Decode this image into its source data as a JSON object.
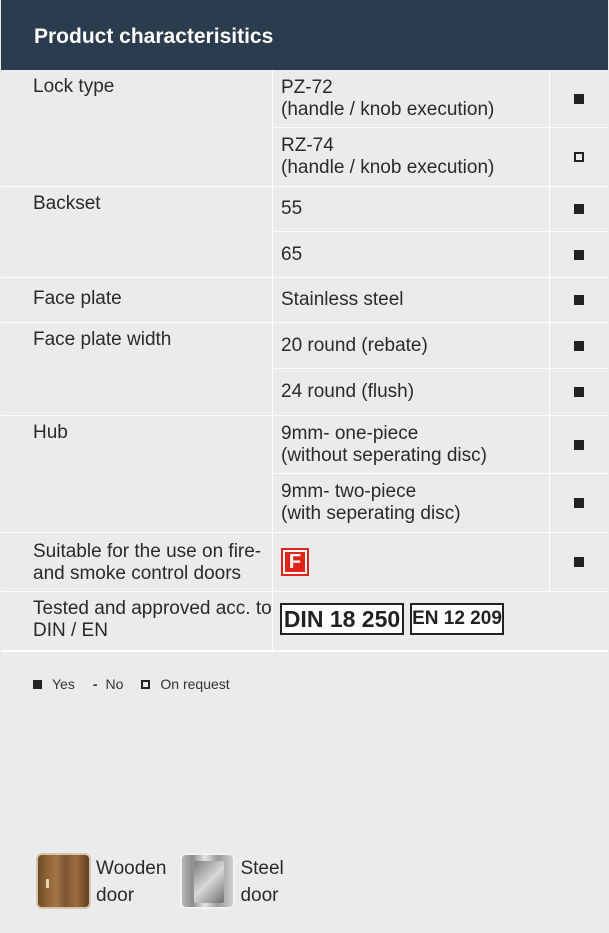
{
  "header": {
    "title": "Product characterisitics"
  },
  "rows": [
    {
      "label": "Lock type",
      "values": [
        {
          "text": "PZ-72\n(handle / knob execution)",
          "mark": "yes"
        },
        {
          "text": "RZ-74\n(handle / knob execution)",
          "mark": "request"
        }
      ]
    },
    {
      "label": "Backset",
      "values": [
        {
          "text": "55",
          "mark": "yes"
        },
        {
          "text": "65",
          "mark": "yes"
        }
      ]
    },
    {
      "label": "Face plate",
      "values": [
        {
          "text": "Stainless steel",
          "mark": "yes"
        }
      ]
    },
    {
      "label": "Face plate width",
      "values": [
        {
          "text": "20 round (rebate)",
          "mark": "yes"
        },
        {
          "text": "24 round (flush)",
          "mark": "yes"
        }
      ]
    },
    {
      "label": "Hub",
      "values": [
        {
          "text": "9mm- one-piece\n(without seperating disc)",
          "mark": "yes"
        },
        {
          "text": "9mm- two-piece\n(with seperating disc)",
          "mark": "yes"
        }
      ]
    },
    {
      "label": "Suitable for the use on fire-\nand smoke control doors",
      "badge": "F",
      "mark": "yes"
    },
    {
      "label": "Tested and approved acc. to\nDIN / EN",
      "din": [
        "DIN 18 250",
        "EN 12 209"
      ]
    }
  ],
  "legend": {
    "yes": "Yes",
    "no_symbol": "-",
    "no": "No",
    "request": "On request"
  },
  "doors": [
    {
      "label": "Wooden door",
      "line1": "Wooden",
      "line2": "door"
    },
    {
      "label": "Steel door",
      "line1": "Steel",
      "line2": "door"
    }
  ],
  "colors": {
    "header_bg": "#2a3c4e",
    "page_bg": "#e9ebed",
    "fire_red": "#e2231a"
  }
}
